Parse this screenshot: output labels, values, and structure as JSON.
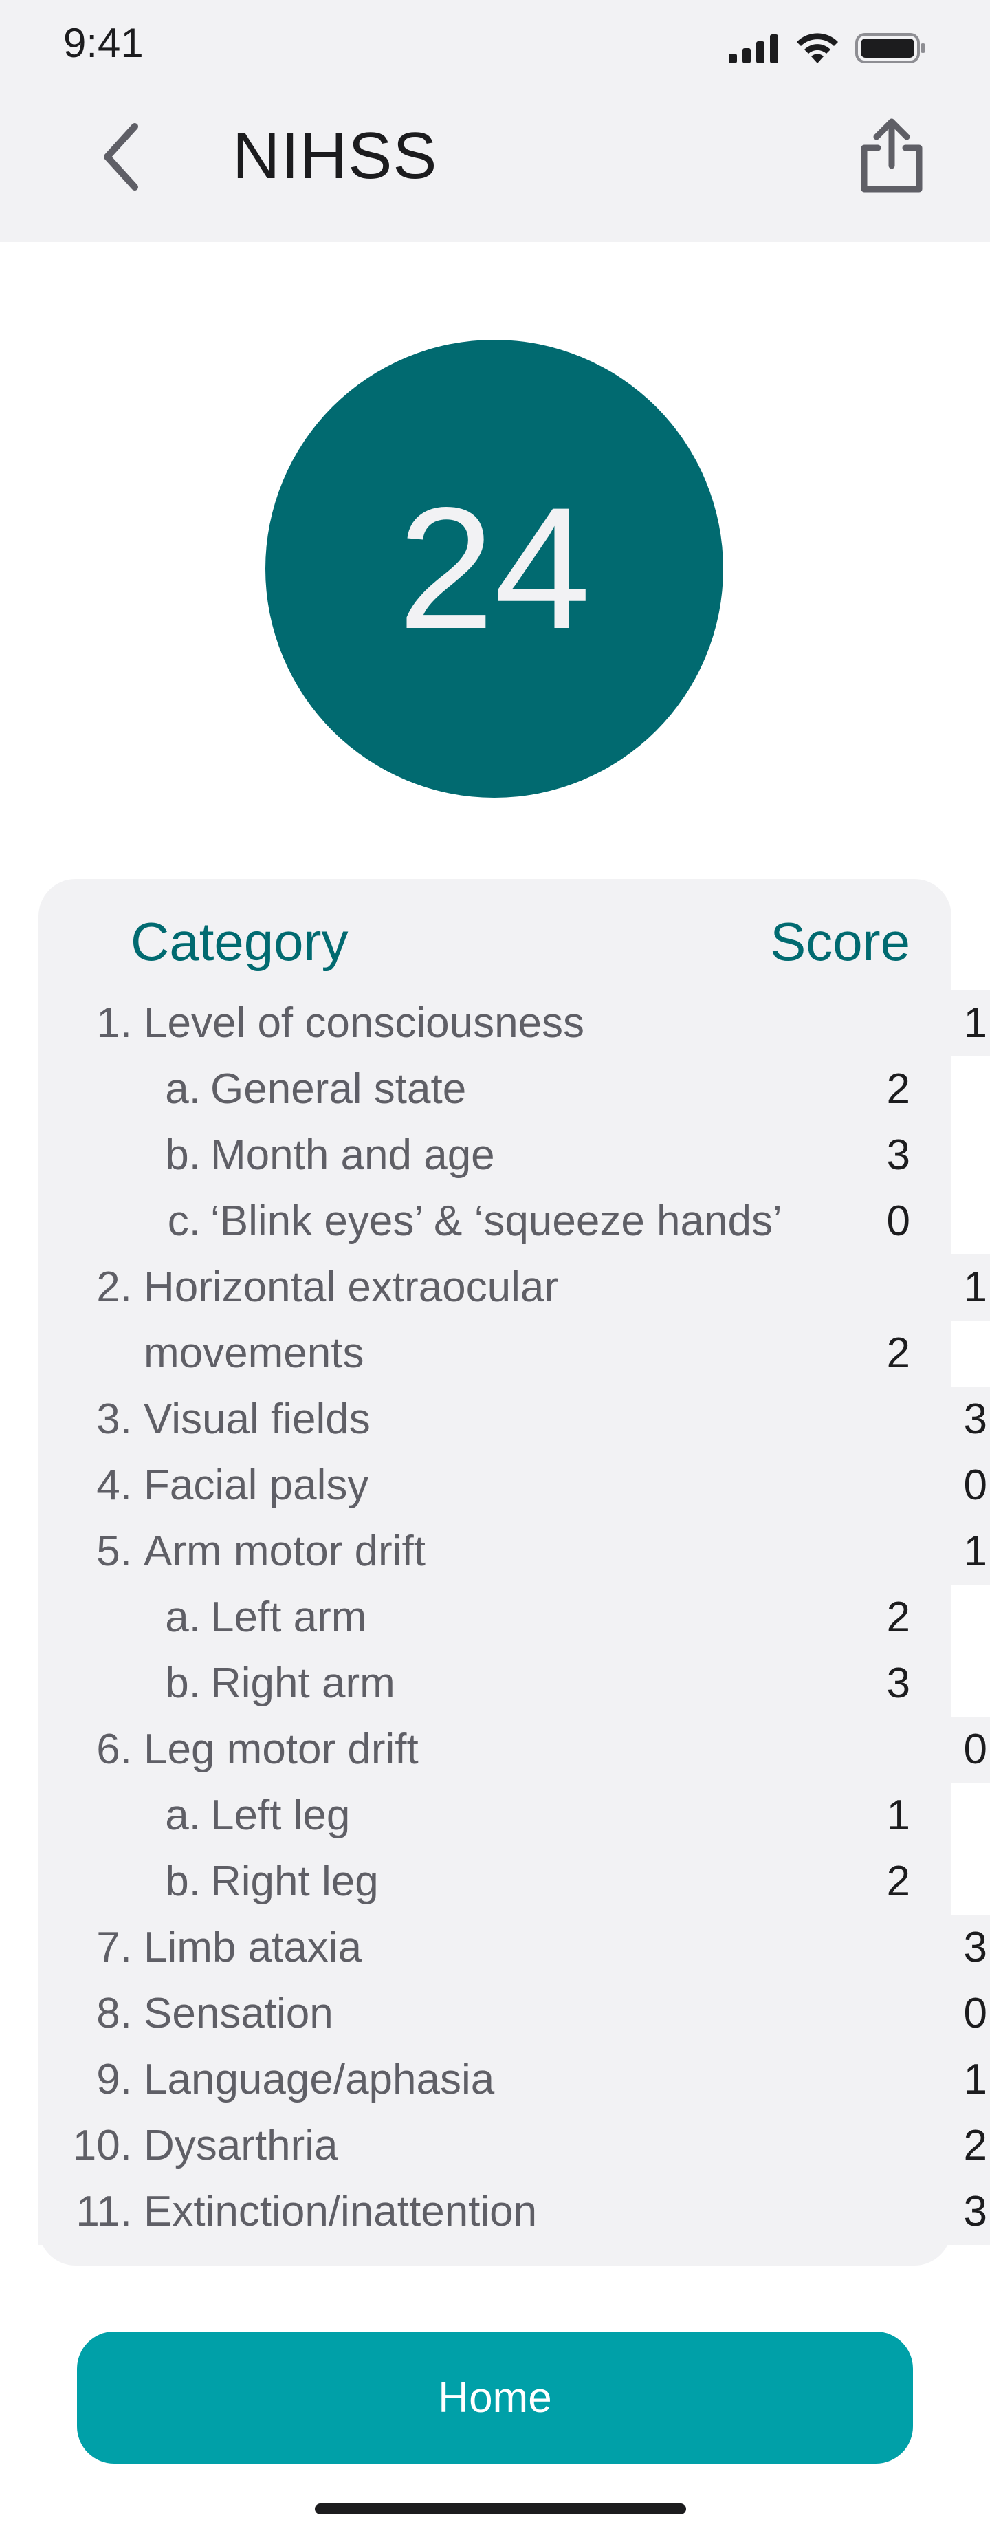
{
  "status_bar": {
    "time": "9:41"
  },
  "nav": {
    "title": "NIHSS",
    "back_icon": "chevron-left-icon",
    "share_icon": "share-icon"
  },
  "score": {
    "value": "24"
  },
  "table": {
    "header": {
      "category": "Category",
      "score": "Score"
    },
    "rows": [
      {
        "num": "1.",
        "label": "Level of consciousness",
        "score": "1",
        "level": "top"
      },
      {
        "num": "a.",
        "label": "General state",
        "score": "2",
        "level": "sub"
      },
      {
        "num": "b.",
        "label": "Month and age",
        "score": "3",
        "level": "sub"
      },
      {
        "num": "c.",
        "label": "‘Blink eyes’ & ‘squeeze hands’",
        "score": "0",
        "level": "sub"
      },
      {
        "num": "2.",
        "label": "Horizontal extraocular",
        "score": "1",
        "level": "top"
      },
      {
        "num": "",
        "label": "movements",
        "score": "2",
        "level": "cont"
      },
      {
        "num": "3.",
        "label": "Visual fields",
        "score": "3",
        "level": "top"
      },
      {
        "num": "4.",
        "label": "Facial palsy",
        "score": "0",
        "level": "top"
      },
      {
        "num": "5.",
        "label": "Arm motor drift",
        "score": "1",
        "level": "top"
      },
      {
        "num": "a.",
        "label": "Left arm",
        "score": "2",
        "level": "sub"
      },
      {
        "num": "b.",
        "label": "Right arm",
        "score": "3",
        "level": "sub"
      },
      {
        "num": "6.",
        "label": "Leg motor drift",
        "score": "0",
        "level": "top"
      },
      {
        "num": "a.",
        "label": "Left leg",
        "score": "1",
        "level": "sub"
      },
      {
        "num": "b.",
        "label": "Right leg",
        "score": "2",
        "level": "sub"
      },
      {
        "num": "7.",
        "label": "Limb ataxia",
        "score": "3",
        "level": "top"
      },
      {
        "num": "8.",
        "label": "Sensation",
        "score": "0",
        "level": "top"
      },
      {
        "num": "9.",
        "label": "Language/aphasia",
        "score": "1",
        "level": "top"
      },
      {
        "num": "10.",
        "label": "Dysarthria",
        "score": "2",
        "level": "top"
      },
      {
        "num": "11.",
        "label": "Extinction/inattention",
        "score": "3",
        "level": "top"
      }
    ]
  },
  "home_button": {
    "label": "Home"
  },
  "colors": {
    "accent_dark": "#016a70",
    "accent_button": "#00a0a8",
    "header_bg": "#f2f2f4"
  }
}
